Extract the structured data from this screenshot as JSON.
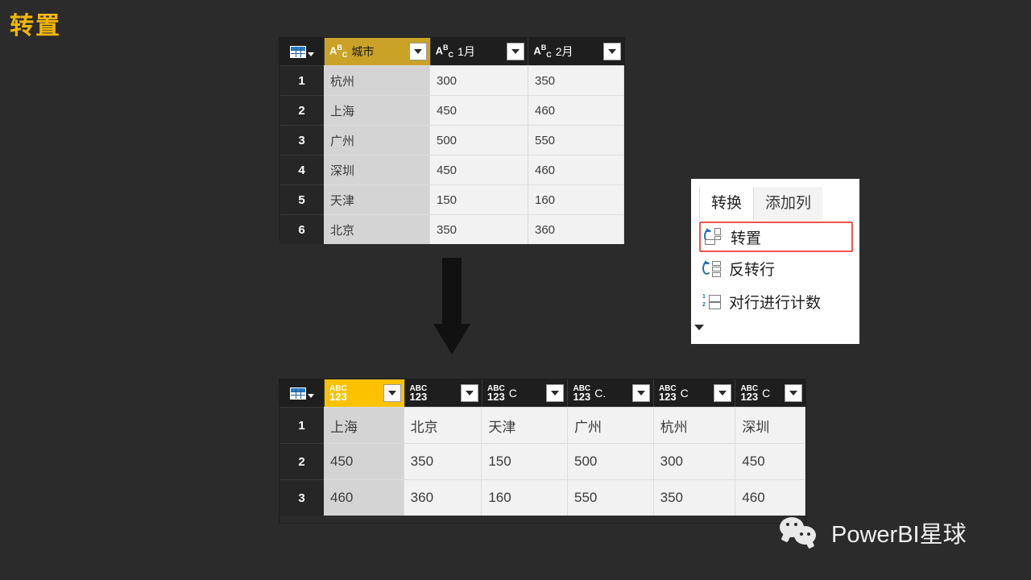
{
  "slide": {
    "title": "转置",
    "background_color": "#2b2b2b",
    "title_color": "#f5b700"
  },
  "source_table": {
    "corner_icon": "table-grid-icon",
    "columns": [
      {
        "name": "城市",
        "type_icon": "abc-text-icon",
        "selected": true,
        "highlight_color": "#c9a227"
      },
      {
        "name": "1月",
        "type_icon": "abc-text-icon",
        "selected": false
      },
      {
        "name": "2月",
        "type_icon": "abc-text-icon",
        "selected": false
      }
    ],
    "rows": [
      {
        "num": "1",
        "cells": [
          "杭州",
          "300",
          "350"
        ]
      },
      {
        "num": "2",
        "cells": [
          "上海",
          "450",
          "460"
        ]
      },
      {
        "num": "3",
        "cells": [
          "广州",
          "500",
          "550"
        ]
      },
      {
        "num": "4",
        "cells": [
          "深圳",
          "450",
          "460"
        ]
      },
      {
        "num": "5",
        "cells": [
          "天津",
          "150",
          "160"
        ]
      },
      {
        "num": "6",
        "cells": [
          "北京",
          "350",
          "360"
        ]
      }
    ]
  },
  "result_table": {
    "corner_icon": "table-grid-icon",
    "columns": [
      {
        "name": "",
        "type_icon": "abc123-any-icon",
        "selected": true,
        "highlight_color": "#fcc200"
      },
      {
        "name": "",
        "type_icon": "abc123-any-icon",
        "selected": false
      },
      {
        "name": "C",
        "type_icon": "abc123-any-icon",
        "selected": false
      },
      {
        "name": "C.",
        "type_icon": "abc123-any-icon",
        "selected": false
      },
      {
        "name": "C",
        "type_icon": "abc123-any-icon",
        "selected": false
      },
      {
        "name": "C",
        "type_icon": "abc123-any-icon",
        "selected": false
      }
    ],
    "rows": [
      {
        "num": "1",
        "cells": [
          "上海",
          "北京",
          "天津",
          "广州",
          "杭州",
          "深圳"
        ]
      },
      {
        "num": "2",
        "cells": [
          "450",
          "350",
          "150",
          "500",
          "300",
          "450"
        ]
      },
      {
        "num": "3",
        "cells": [
          "460",
          "360",
          "160",
          "550",
          "350",
          "460"
        ]
      }
    ]
  },
  "ribbon": {
    "tabs": [
      {
        "label": "转换",
        "active": true
      },
      {
        "label": "添加列",
        "active": false
      }
    ],
    "items": [
      {
        "label": "转置",
        "icon": "transpose-icon",
        "highlighted": true,
        "highlight_color": "#ef5350"
      },
      {
        "label": "反转行",
        "icon": "reverse-rows-icon",
        "highlighted": false
      },
      {
        "label": "对行进行计数",
        "icon": "count-rows-icon",
        "highlighted": false
      }
    ]
  },
  "watermark": {
    "icon": "wechat-icon",
    "text": "PowerBI星球"
  }
}
